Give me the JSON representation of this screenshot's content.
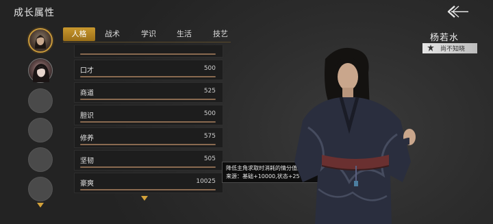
{
  "header": {
    "title": "成长属性"
  },
  "tabs": [
    {
      "label": "人格",
      "active": true
    },
    {
      "label": "战术",
      "active": false
    },
    {
      "label": "学识",
      "active": false
    },
    {
      "label": "生活",
      "active": false
    },
    {
      "label": "技艺",
      "active": false
    }
  ],
  "attributes": [
    {
      "name": "口才",
      "value": "500"
    },
    {
      "name": "商道",
      "value": "525"
    },
    {
      "name": "胆识",
      "value": "500"
    },
    {
      "name": "修养",
      "value": "575"
    },
    {
      "name": "坚韧",
      "value": "505"
    },
    {
      "name": "豪爽",
      "value": "10025"
    }
  ],
  "tooltip": {
    "line1": "降低主角求取时消耗的情分值。",
    "line2": "来源：基础+10000,状态+25"
  },
  "character": {
    "name": "杨若水",
    "trait": "尚不知晓"
  },
  "colors": {
    "accent_gold": "#c9982e",
    "panel_row": "#1d1d1d",
    "bar": "#8a6a50"
  },
  "icons": [
    "back-arrow-icon",
    "chevron-down-icon",
    "trait-emblem-icon"
  ]
}
